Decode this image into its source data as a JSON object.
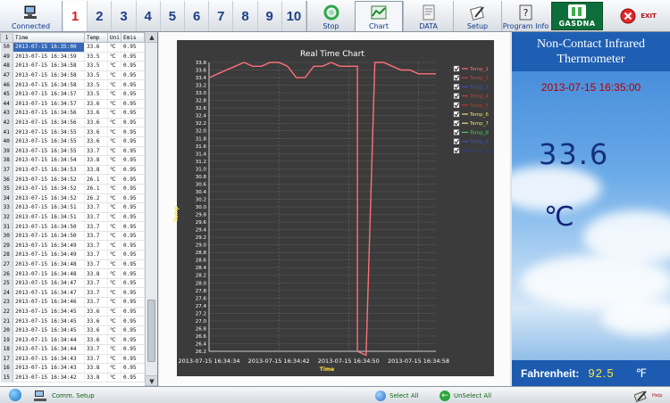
{
  "toolbar": {
    "connected_label": "Connected",
    "channels": [
      "1",
      "2",
      "3",
      "4",
      "5",
      "6",
      "7",
      "8",
      "9",
      "10"
    ],
    "active_channel": 0,
    "stop_label": "Stop",
    "chart_label": "Chart",
    "data_label": "DATA",
    "setup_label": "Setup",
    "info_label": "Program Info",
    "brand": "GASDNA",
    "exit_label": "EXIT"
  },
  "table": {
    "headers": {
      "num": "1",
      "time": "Time",
      "temp": "Temp",
      "unit": "Uni",
      "emis": "Emis"
    },
    "rows": [
      {
        "n": "50",
        "t": "2013-07-15 16:35:00",
        "v": "33.6",
        "u": "℃",
        "e": "0.95"
      },
      {
        "n": "49",
        "t": "2013-07-15 16:34:59",
        "v": "33.5",
        "u": "℃",
        "e": "0.95"
      },
      {
        "n": "48",
        "t": "2013-07-15 16:34:58",
        "v": "33.5",
        "u": "℃",
        "e": "0.95"
      },
      {
        "n": "47",
        "t": "2013-07-15 16:34:58",
        "v": "33.5",
        "u": "℃",
        "e": "0.95"
      },
      {
        "n": "46",
        "t": "2013-07-15 16:34:58",
        "v": "33.5",
        "u": "℃",
        "e": "0.95"
      },
      {
        "n": "45",
        "t": "2013-07-15 16:34:57",
        "v": "33.5",
        "u": "℃",
        "e": "0.95"
      },
      {
        "n": "44",
        "t": "2013-07-15 16:34:57",
        "v": "33.6",
        "u": "℃",
        "e": "0.95"
      },
      {
        "n": "43",
        "t": "2013-07-15 16:34:56",
        "v": "33.6",
        "u": "℃",
        "e": "0.95"
      },
      {
        "n": "42",
        "t": "2013-07-15 16:34:56",
        "v": "33.6",
        "u": "℃",
        "e": "0.95"
      },
      {
        "n": "41",
        "t": "2013-07-15 16:34:55",
        "v": "33.6",
        "u": "℃",
        "e": "0.95"
      },
      {
        "n": "40",
        "t": "2013-07-15 16:34:55",
        "v": "33.6",
        "u": "℃",
        "e": "0.95"
      },
      {
        "n": "39",
        "t": "2013-07-15 16:34:55",
        "v": "33.7",
        "u": "℃",
        "e": "0.95"
      },
      {
        "n": "38",
        "t": "2013-07-15 16:34:54",
        "v": "33.8",
        "u": "℃",
        "e": "0.95"
      },
      {
        "n": "37",
        "t": "2013-07-15 16:34:53",
        "v": "33.8",
        "u": "℃",
        "e": "0.95"
      },
      {
        "n": "36",
        "t": "2013-07-15 16:34:52",
        "v": "26.1",
        "u": "℃",
        "e": "0.95"
      },
      {
        "n": "35",
        "t": "2013-07-15 16:34:52",
        "v": "26.1",
        "u": "℃",
        "e": "0.95"
      },
      {
        "n": "34",
        "t": "2013-07-15 16:34:52",
        "v": "26.2",
        "u": "℃",
        "e": "0.95"
      },
      {
        "n": "33",
        "t": "2013-07-15 16:34:51",
        "v": "33.7",
        "u": "℃",
        "e": "0.95"
      },
      {
        "n": "32",
        "t": "2013-07-15 16:34:51",
        "v": "33.7",
        "u": "℃",
        "e": "0.95"
      },
      {
        "n": "31",
        "t": "2013-07-15 16:34:50",
        "v": "33.7",
        "u": "℃",
        "e": "0.95"
      },
      {
        "n": "30",
        "t": "2013-07-15 16:34:50",
        "v": "33.7",
        "u": "℃",
        "e": "0.95"
      },
      {
        "n": "29",
        "t": "2013-07-15 16:34:49",
        "v": "33.7",
        "u": "℃",
        "e": "0.95"
      },
      {
        "n": "28",
        "t": "2013-07-15 16:34:49",
        "v": "33.7",
        "u": "℃",
        "e": "0.95"
      },
      {
        "n": "27",
        "t": "2013-07-15 16:34:48",
        "v": "33.7",
        "u": "℃",
        "e": "0.95"
      },
      {
        "n": "26",
        "t": "2013-07-15 16:34:48",
        "v": "33.8",
        "u": "℃",
        "e": "0.95"
      },
      {
        "n": "25",
        "t": "2013-07-15 16:34:47",
        "v": "33.7",
        "u": "℃",
        "e": "0.95"
      },
      {
        "n": "24",
        "t": "2013-07-15 16:34:47",
        "v": "33.7",
        "u": "℃",
        "e": "0.95"
      },
      {
        "n": "23",
        "t": "2013-07-15 16:34:46",
        "v": "33.7",
        "u": "℃",
        "e": "0.95"
      },
      {
        "n": "22",
        "t": "2013-07-15 16:34:45",
        "v": "33.6",
        "u": "℃",
        "e": "0.95"
      },
      {
        "n": "21",
        "t": "2013-07-15 16:34:45",
        "v": "33.6",
        "u": "℃",
        "e": "0.95"
      },
      {
        "n": "20",
        "t": "2013-07-15 16:34:45",
        "v": "33.6",
        "u": "℃",
        "e": "0.95"
      },
      {
        "n": "19",
        "t": "2013-07-15 16:34:44",
        "v": "33.6",
        "u": "℃",
        "e": "0.95"
      },
      {
        "n": "18",
        "t": "2013-07-15 16:34:44",
        "v": "33.7",
        "u": "℃",
        "e": "0.95"
      },
      {
        "n": "17",
        "t": "2013-07-15 16:34:43",
        "v": "33.7",
        "u": "℃",
        "e": "0.95"
      },
      {
        "n": "16",
        "t": "2013-07-15 16:34:43",
        "v": "33.8",
        "u": "℃",
        "e": "0.95"
      },
      {
        "n": "15",
        "t": "2013-07-15 16:34:42",
        "v": "33.8",
        "u": "℃",
        "e": "0.95"
      }
    ]
  },
  "chart_data": {
    "type": "line",
    "title": "Real Time Chart",
    "xlabel": "Time",
    "ylabel": "Temp",
    "ylim": [
      26.2,
      33.8
    ],
    "ytick_step": 0.2,
    "xticks": [
      "2013-07-15 16:34:34",
      "2013-07-15 16:34:42",
      "2013-07-15 16:34:50",
      "2013-07-15 16:34:58"
    ],
    "xrange": [
      "2013-07-15 16:34:34",
      "2013-07-15 16:35:00"
    ],
    "grid": true,
    "legend_position": "right",
    "series": [
      {
        "name": "Temp_1",
        "color": "#ff6f7a",
        "checked": true,
        "x": [
          "2013-07-15 16:34:34",
          "2013-07-15 16:34:35",
          "2013-07-15 16:34:36",
          "2013-07-15 16:34:37",
          "2013-07-15 16:34:38",
          "2013-07-15 16:34:39",
          "2013-07-15 16:34:40",
          "2013-07-15 16:34:41",
          "2013-07-15 16:34:42",
          "2013-07-15 16:34:43",
          "2013-07-15 16:34:44",
          "2013-07-15 16:34:45",
          "2013-07-15 16:34:46",
          "2013-07-15 16:34:47",
          "2013-07-15 16:34:48",
          "2013-07-15 16:34:49",
          "2013-07-15 16:34:50",
          "2013-07-15 16:34:51",
          "2013-07-15 16:34:51",
          "2013-07-15 16:34:52",
          "2013-07-15 16:34:52",
          "2013-07-15 16:34:53",
          "2013-07-15 16:34:54",
          "2013-07-15 16:34:55",
          "2013-07-15 16:34:56",
          "2013-07-15 16:34:57",
          "2013-07-15 16:34:58",
          "2013-07-15 16:34:59",
          "2013-07-15 16:35:00"
        ],
        "y": [
          33.4,
          33.5,
          33.6,
          33.7,
          33.8,
          33.7,
          33.7,
          33.8,
          33.8,
          33.7,
          33.4,
          33.4,
          33.7,
          33.7,
          33.8,
          33.7,
          33.7,
          33.7,
          26.2,
          26.1,
          26.1,
          33.8,
          33.8,
          33.7,
          33.6,
          33.6,
          33.5,
          33.5,
          33.5
        ]
      },
      {
        "name": "Temp_2",
        "color": "#d23c3c",
        "checked": true
      },
      {
        "name": "Temp_3",
        "color": "#3b55c8",
        "checked": true
      },
      {
        "name": "Temp_4",
        "color": "#d23c3c",
        "checked": true
      },
      {
        "name": "Temp_5",
        "color": "#c0392b",
        "checked": true
      },
      {
        "name": "Temp_6",
        "color": "#e8e07a",
        "checked": true
      },
      {
        "name": "Temp_7",
        "color": "#e8e07a",
        "checked": true
      },
      {
        "name": "Temp_8",
        "color": "#4fc86a",
        "checked": true
      },
      {
        "name": "Temp_9",
        "color": "#3b55c8",
        "checked": true
      },
      {
        "name": "Temp_10",
        "color": "#2a3f9e",
        "checked": true
      }
    ]
  },
  "info": {
    "title": "Non-Contact Infrared Thermometer",
    "datetime": "2013-07-15 16:35:00",
    "temperature": "33.6",
    "unit": "℃",
    "fahrenheit_label": "Fahrenheit:",
    "fahrenheit_value": "92.5",
    "fahrenheit_unit": "℉"
  },
  "status": {
    "comm_setup": "Comm. Setup",
    "select_all": "Select All",
    "unselect_all": "UnSelect All",
    "tools_label": "Help"
  },
  "colors": {
    "chart_bg": "#3b3b3b",
    "line": "#ff6f7a",
    "panel_blue": "#1e5fb3",
    "accent_red": "#d21f1f"
  }
}
